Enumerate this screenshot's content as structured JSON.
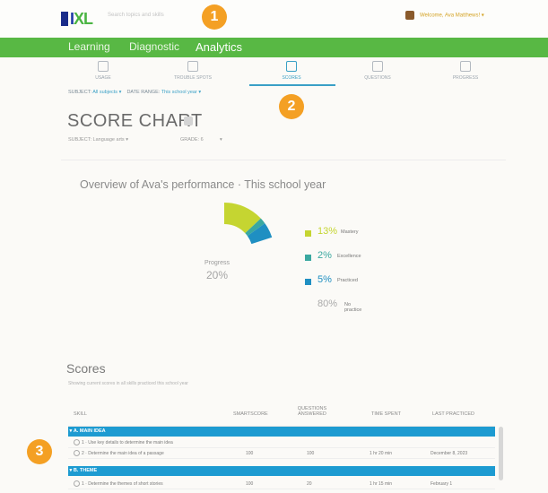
{
  "header": {
    "logo_text": "IXL",
    "search_placeholder": "Search topics and skills",
    "user_label": "Welcome, Ava Matthews! ▾"
  },
  "nav": {
    "items": [
      "Learning",
      "Diagnostic",
      "Analytics"
    ],
    "active": "Analytics"
  },
  "subnav": {
    "items": [
      "USAGE",
      "TROUBLE SPOTS",
      "SCORES",
      "QUESTIONS",
      "PROGRESS"
    ],
    "active": "SCORES"
  },
  "filters": {
    "subject_label": "SUBJECT:",
    "subject_value": "All subjects ▾",
    "date_label": "DATE RANGE:",
    "date_value": "This school year ▾"
  },
  "badges": [
    "1",
    "2",
    "3"
  ],
  "score_chart": {
    "title": "SCORE CHART",
    "subject_label": "SUBJECT:",
    "subject_value": "Language arts",
    "grade_label": "GRADE:",
    "grade_value": "6"
  },
  "overview": {
    "title": "Overview of Ava's performance · This school year",
    "center_label": "Progress",
    "center_value": "20%"
  },
  "chart_data": {
    "type": "pie",
    "categories": [
      "Mastery",
      "Excellence",
      "Practiced",
      "No practice"
    ],
    "values": [
      13,
      2,
      5,
      80
    ],
    "colors": [
      "#c5d531",
      "#3aa8a0",
      "#1f8fc2",
      "#ffffff"
    ]
  },
  "legend": [
    {
      "value": "13%",
      "label": "Mastery",
      "color": "#c5d531"
    },
    {
      "value": "2%",
      "label": "Excellence",
      "color": "#3aa8a0"
    },
    {
      "value": "5%",
      "label": "Practiced",
      "color": "#1f8fc2"
    },
    {
      "value": "80%",
      "label": "No practice",
      "color": ""
    }
  ],
  "scores": {
    "title": "Scores",
    "note": "Showing current scores in all skills practiced this school year",
    "columns": [
      "SKILL",
      "SMARTSCORE",
      "QUESTIONS ANSWERED",
      "TIME SPENT",
      "LAST PRACTICED"
    ],
    "sections": [
      {
        "name": "A. MAIN IDEA",
        "rows": [
          {
            "skill": "1 · Use key details to determine the main idea",
            "score": "",
            "questions": "",
            "time": "",
            "last": ""
          },
          {
            "skill": "2 · Determine the main idea of a passage",
            "score": "100",
            "questions": "100",
            "time": "1 hr 20 min",
            "last": "December 8, 2023"
          }
        ]
      },
      {
        "name": "B. THEME",
        "rows": [
          {
            "skill": "1 · Determine the themes of short stories",
            "score": "100",
            "questions": "20",
            "time": "1 hr 15 min",
            "last": "February 1"
          }
        ]
      }
    ]
  }
}
